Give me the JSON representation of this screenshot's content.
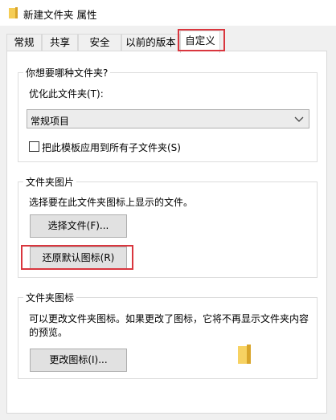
{
  "window": {
    "title": "新建文件夹 属性"
  },
  "tabs": [
    {
      "label": "常规"
    },
    {
      "label": "共享"
    },
    {
      "label": "安全"
    },
    {
      "label": "以前的版本"
    },
    {
      "label": "自定义"
    }
  ],
  "optimize_group": {
    "title": "你想要哪种文件夹?",
    "optimize_label": "优化此文件夹(T):",
    "select_value": "常规项目",
    "apply_checkbox_label": "把此模板应用到所有子文件夹(S)",
    "apply_checked": false
  },
  "picture_group": {
    "title": "文件夹图片",
    "description": "选择要在此文件夹图标上显示的文件。",
    "choose_button": "选择文件(F)...",
    "restore_button": "还原默认图标(R)"
  },
  "icon_group": {
    "title": "文件夹图标",
    "description_line1": "可以更改文件夹图标。如果更改了图标，它将不再显示文件夹内容",
    "description_line2": "的预览。",
    "change_button": "更改图标(I)..."
  },
  "colors": {
    "highlight_box": "#d9363e",
    "folder": "#f5c542"
  }
}
